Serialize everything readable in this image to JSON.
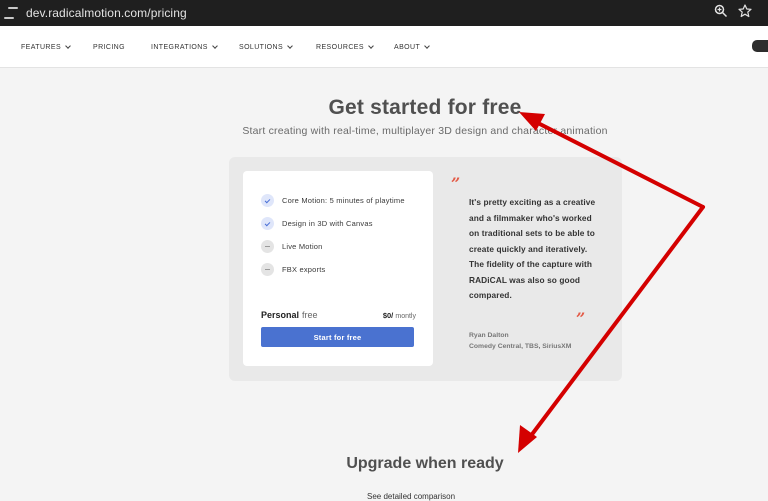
{
  "browser": {
    "url": "dev.radicalmotion.com/pricing",
    "icons": [
      "site-settings-icon",
      "zoom-icon",
      "star-icon"
    ]
  },
  "nav": {
    "items": [
      {
        "label": "FEATURES",
        "dropdown": true
      },
      {
        "label": "PRICING",
        "dropdown": false
      },
      {
        "label": "INTEGRATIONS",
        "dropdown": true
      },
      {
        "label": "SOLUTIONS",
        "dropdown": true
      },
      {
        "label": "RESOURCES",
        "dropdown": true
      },
      {
        "label": "ABOUT",
        "dropdown": true
      }
    ],
    "social_icon": "discord-icon"
  },
  "hero": {
    "title": "Get started for free",
    "subtitle": "Start creating with real-time, multiplayer 3D design and character animation"
  },
  "plan": {
    "features": [
      {
        "label": "Core Motion: 5 minutes of playtime",
        "included": true
      },
      {
        "label": "Design in 3D with Canvas",
        "included": true
      },
      {
        "label": "Live Motion",
        "included": false
      },
      {
        "label": "FBX exports",
        "included": false
      }
    ],
    "name": "Personal",
    "tier": "free",
    "price": "$0/",
    "period": "montly",
    "cta": "Start for free"
  },
  "testimonial": {
    "quote_mark": "”",
    "text": "It's pretty exciting as a creative and a filmmaker who's worked on traditional sets to be able to create quickly and iteratively. The fidelity of the capture with RADiCAL was also so good compared.",
    "author": "Ryan Dalton",
    "affiliation": "Comedy Central, TBS, SiriusXM"
  },
  "upgrade": {
    "title": "Upgrade when ready",
    "link": "See detailed comparison"
  },
  "colors": {
    "accent": "#4a72d0",
    "quote": "#e35a46",
    "annotation_arrow": "#d40000"
  }
}
